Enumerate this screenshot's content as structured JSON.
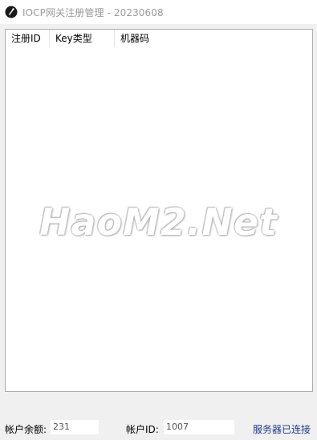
{
  "window": {
    "title": "IOCP网关注册管理 - 20230608"
  },
  "list": {
    "columns": [
      "注册ID",
      "Key类型",
      "机器码"
    ],
    "rows": []
  },
  "watermark": "HaoM2.Net",
  "status": {
    "balance_label": "帐户余额:",
    "balance_value": "231",
    "account_label": "帐户ID:",
    "account_value": "1007",
    "connection_text": "服务器已连接",
    "connection_color": "#1f3a8a"
  }
}
